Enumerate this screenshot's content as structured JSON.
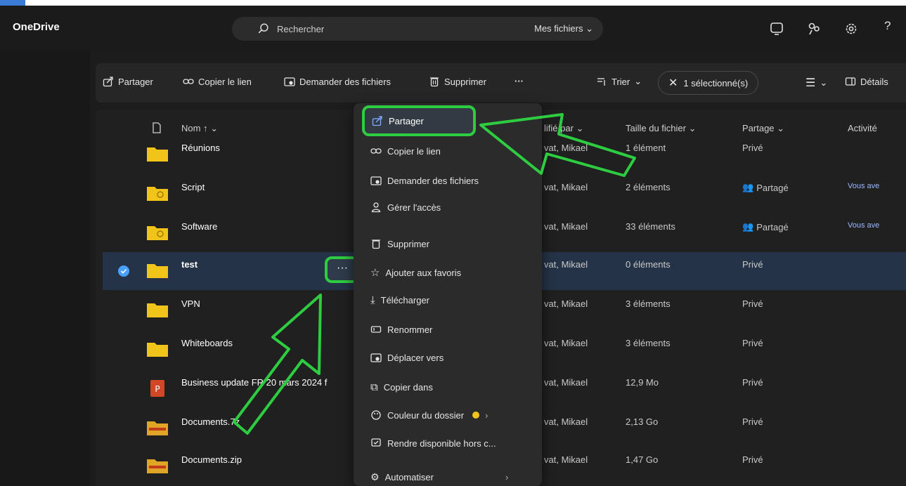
{
  "app": {
    "name": "OneDrive"
  },
  "search": {
    "placeholder": "Rechercher",
    "scope": "Mes fichiers"
  },
  "toolbar": {
    "share": "Partager",
    "copy_link": "Copier le lien",
    "request_files": "Demander des fichiers",
    "delete": "Supprimer",
    "more": "···",
    "sort": "Trier",
    "selected": "1 sélectionné(s)",
    "details": "Détails"
  },
  "columns": {
    "name": "Nom ↑",
    "modified_by": "lifié par",
    "file_size": "Taille du fichier",
    "sharing": "Partage",
    "activity": "Activité"
  },
  "rows": [
    {
      "name": "Réunions",
      "modified_by": "vat, Mikael",
      "size": "1 élément",
      "sharing": "Privé",
      "activity": ""
    },
    {
      "name": "Script",
      "modified_by": "vat, Mikael",
      "size": "2 éléments",
      "sharing": "Partagé",
      "activity": "Vous ave"
    },
    {
      "name": "Software",
      "modified_by": "vat, Mikael",
      "size": "33 éléments",
      "sharing": "Partagé",
      "activity": "Vous ave"
    },
    {
      "name": "test",
      "modified_by": "vat, Mikael",
      "size": "0 éléments",
      "sharing": "Privé",
      "activity": ""
    },
    {
      "name": "VPN",
      "modified_by": "vat, Mikael",
      "size": "3 éléments",
      "sharing": "Privé",
      "activity": ""
    },
    {
      "name": "Whiteboards",
      "modified_by": "vat, Mikael",
      "size": "3 éléments",
      "sharing": "Privé",
      "activity": ""
    },
    {
      "name": "Business update FR 20 mars 2024 f",
      "modified_by": "vat, Mikael",
      "size": "12,9 Mo",
      "sharing": "Privé",
      "activity": ""
    },
    {
      "name": "Documents.7z",
      "modified_by": "vat, Mikael",
      "size": "2,13 Go",
      "sharing": "Privé",
      "activity": ""
    },
    {
      "name": "Documents.zip",
      "modified_by": "vat, Mikael",
      "size": "1,47 Go",
      "sharing": "Privé",
      "activity": ""
    }
  ],
  "context_menu": {
    "items": [
      "Partager",
      "Copier le lien",
      "Demander des fichiers",
      "Gérer l'accès",
      "Supprimer",
      "Ajouter aux favoris",
      "Télécharger",
      "Renommer",
      "Déplacer vers",
      "Copier dans",
      "Couleur du dossier",
      "Rendre disponible hors c...",
      "Automatiser"
    ]
  },
  "colors": {
    "highlight": "#2ecc40",
    "folder": "#f0c419",
    "selection": "#243347",
    "accent": "#4aa0ff",
    "ppt": "#d24726",
    "archive": "#e0a526"
  }
}
